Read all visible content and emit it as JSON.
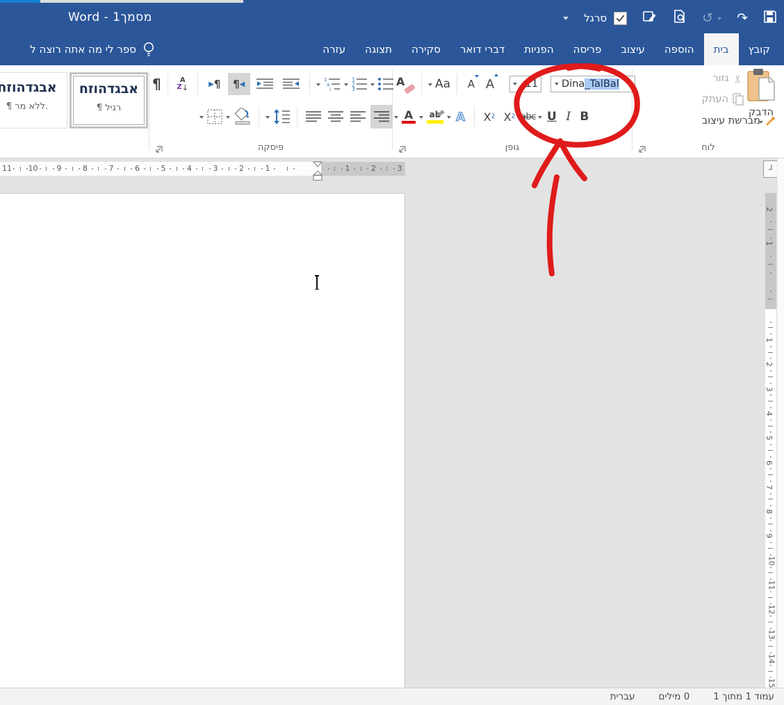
{
  "titlebar": {
    "title": "מסמך1 - Word",
    "qat": {
      "ruler_label": "סרגל"
    }
  },
  "tabs": {
    "items": [
      {
        "name": "file",
        "label": "קובץ",
        "active": false
      },
      {
        "name": "home",
        "label": "בית",
        "active": true
      },
      {
        "name": "insert",
        "label": "הוספה",
        "active": false
      },
      {
        "name": "design",
        "label": "עיצוב",
        "active": false
      },
      {
        "name": "layout",
        "label": "פריסה",
        "active": false
      },
      {
        "name": "references",
        "label": "הפניות",
        "active": false
      },
      {
        "name": "mailings",
        "label": "דברי דואר",
        "active": false
      },
      {
        "name": "review",
        "label": "סקירה",
        "active": false
      },
      {
        "name": "view",
        "label": "תצוגה",
        "active": false
      },
      {
        "name": "help",
        "label": "עזרה",
        "active": false
      }
    ],
    "tell_me": "ספר לי מה אתה רוצה ל"
  },
  "ribbon": {
    "clipboard": {
      "label": "לוח",
      "paste": "הדבק",
      "cut": "גזור",
      "copy": "העתק",
      "format_painter": "מברשת עיצוב"
    },
    "font": {
      "label": "גופן",
      "font_name": "Dina",
      "font_name_selected": "_TalBal",
      "font_size": "11"
    },
    "paragraph": {
      "label": "פיסקה"
    },
    "styles": {
      "style1_preview": "אבגדהוזח",
      "style1_name": "¶ רגיל",
      "style2_preview": "אבגדהוזח",
      "style2_name": "¶ ללא מר."
    }
  },
  "icons": {
    "pilcrow": "¶",
    "scissors": "✂",
    "bold": "B",
    "italic": "I",
    "underline": "U",
    "strike": "abc",
    "x_letter": "X",
    "two": "2",
    "change_case": "Aa",
    "letter_a": "A",
    "highlight_ab": "ab",
    "sort_a": "A",
    "sort_z": "Z",
    "sort_arrow": "↓",
    "undo": "↺",
    "redo": "↷",
    "ltr_tri": "▶",
    "rtl_tri": "◀",
    "tab_selector": "┘"
  },
  "ruler": {
    "h_left_numbers": [
      11,
      10,
      9,
      8,
      7,
      6,
      5,
      4,
      3,
      2,
      1
    ],
    "h_right_numbers": [
      1,
      2,
      3
    ],
    "v_margin_numbers": [
      2,
      1
    ],
    "v_numbers": [
      1,
      2,
      3,
      4,
      5,
      6,
      7,
      8,
      9,
      10,
      11,
      12,
      13,
      14,
      15
    ]
  },
  "statusbar": {
    "page_info": "עמוד 1 מתוך 1",
    "word_count": "0 מילים",
    "language": "עברית"
  },
  "colors": {
    "brand_blue": "#2b579a",
    "bright_blue": "#1583d3",
    "annotation_red": "#e01b1b",
    "selection_blue": "#a9c9f2",
    "highlight_yellow": "#ffef00",
    "font_color_red": "#e00000",
    "clipboard_tan": "#f0c38c",
    "icon_blue": "#2f70b5",
    "sort_purple": "#7030a0"
  }
}
